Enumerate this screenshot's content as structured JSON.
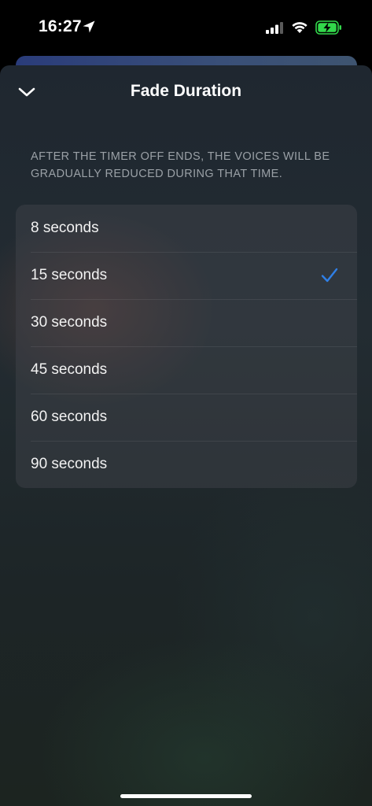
{
  "status_bar": {
    "time": "16:27",
    "location_icon": "location-arrow-icon",
    "signal_icon": "cellular-signal-icon",
    "wifi_icon": "wifi-icon",
    "battery_icon": "battery-charging-icon",
    "battery_color": "#32d74b"
  },
  "sheet": {
    "title": "Fade Duration",
    "close_icon": "chevron-down-icon",
    "description": "AFTER THE TIMER OFF ENDS, THE VOICES WILL BE GRADUALLY REDUCED DURING THAT TIME.",
    "options": [
      {
        "label": "8 seconds",
        "selected": false
      },
      {
        "label": "15 seconds",
        "selected": true
      },
      {
        "label": "30 seconds",
        "selected": false
      },
      {
        "label": "45 seconds",
        "selected": false
      },
      {
        "label": "60 seconds",
        "selected": false
      },
      {
        "label": "90 seconds",
        "selected": false
      }
    ],
    "check_icon": "checkmark-icon",
    "accent_color": "#2f7fe6"
  }
}
